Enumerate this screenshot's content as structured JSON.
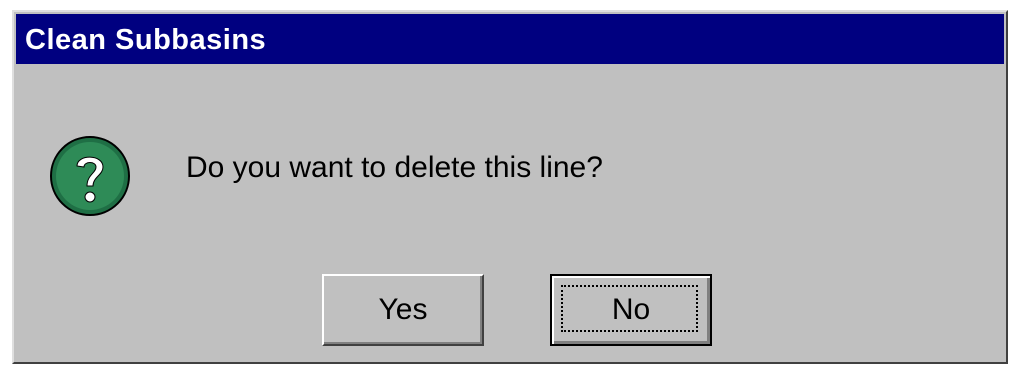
{
  "dialog": {
    "title": "Clean Subbasins",
    "icon": "question-mark-icon",
    "message": "Do you want to delete this line?",
    "buttons": {
      "yes_label": "Yes",
      "no_label": "No"
    },
    "focused_button": "No"
  },
  "colors": {
    "titlebar": "#000080",
    "title_text": "#ffffff",
    "dialog_face": "#c0c0c0",
    "icon_fill": "#2e8b57"
  }
}
